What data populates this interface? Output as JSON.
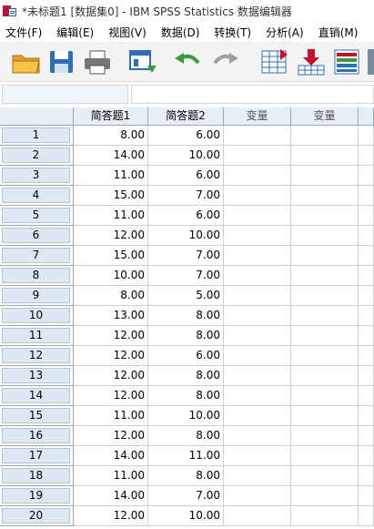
{
  "window": {
    "title": "*未标题1 [数据集0] - IBM SPSS Statistics 数据编辑器"
  },
  "menu": [
    "文件(F)",
    "编辑(E)",
    "视图(V)",
    "数据(D)",
    "转换(T)",
    "分析(A)",
    "直销(M)"
  ],
  "toolbar": {
    "buttons": [
      {
        "name": "open-folder-icon",
        "color": "#e8a020"
      },
      {
        "name": "save-icon",
        "color": "#2d6fb5"
      },
      {
        "name": "print-icon",
        "color": "#555555"
      },
      {
        "name": "dialog-recall-icon",
        "color": "#2d6fb5"
      },
      {
        "name": "undo-icon",
        "color": "#3c9a3c"
      },
      {
        "name": "redo-icon",
        "color": "#999999"
      },
      {
        "name": "goto-case-icon",
        "color": "#2d6fb5"
      },
      {
        "name": "goto-variable-icon",
        "color": "#c8102e"
      },
      {
        "name": "variables-icon",
        "color": "#2d6fb5"
      }
    ]
  },
  "cell_editor": {
    "reference": "",
    "value": ""
  },
  "grid": {
    "columns": [
      "简答题1",
      "简答题2",
      "变量",
      "变量"
    ],
    "rows": [
      {
        "id": "1",
        "c1": "8.00",
        "c2": "6.00"
      },
      {
        "id": "2",
        "c1": "14.00",
        "c2": "10.00"
      },
      {
        "id": "3",
        "c1": "11.00",
        "c2": "6.00"
      },
      {
        "id": "4",
        "c1": "15.00",
        "c2": "7.00"
      },
      {
        "id": "5",
        "c1": "11.00",
        "c2": "6.00"
      },
      {
        "id": "6",
        "c1": "12.00",
        "c2": "10.00"
      },
      {
        "id": "7",
        "c1": "15.00",
        "c2": "7.00"
      },
      {
        "id": "8",
        "c1": "10.00",
        "c2": "7.00"
      },
      {
        "id": "9",
        "c1": "8.00",
        "c2": "5.00"
      },
      {
        "id": "10",
        "c1": "13.00",
        "c2": "8.00"
      },
      {
        "id": "11",
        "c1": "12.00",
        "c2": "8.00"
      },
      {
        "id": "12",
        "c1": "12.00",
        "c2": "6.00"
      },
      {
        "id": "13",
        "c1": "12.00",
        "c2": "8.00"
      },
      {
        "id": "14",
        "c1": "12.00",
        "c2": "8.00"
      },
      {
        "id": "15",
        "c1": "11.00",
        "c2": "10.00"
      },
      {
        "id": "16",
        "c1": "12.00",
        "c2": "8.00"
      },
      {
        "id": "17",
        "c1": "14.00",
        "c2": "11.00"
      },
      {
        "id": "18",
        "c1": "11.00",
        "c2": "8.00"
      },
      {
        "id": "19",
        "c1": "14.00",
        "c2": "7.00"
      },
      {
        "id": "20",
        "c1": "12.00",
        "c2": "10.00"
      }
    ]
  }
}
